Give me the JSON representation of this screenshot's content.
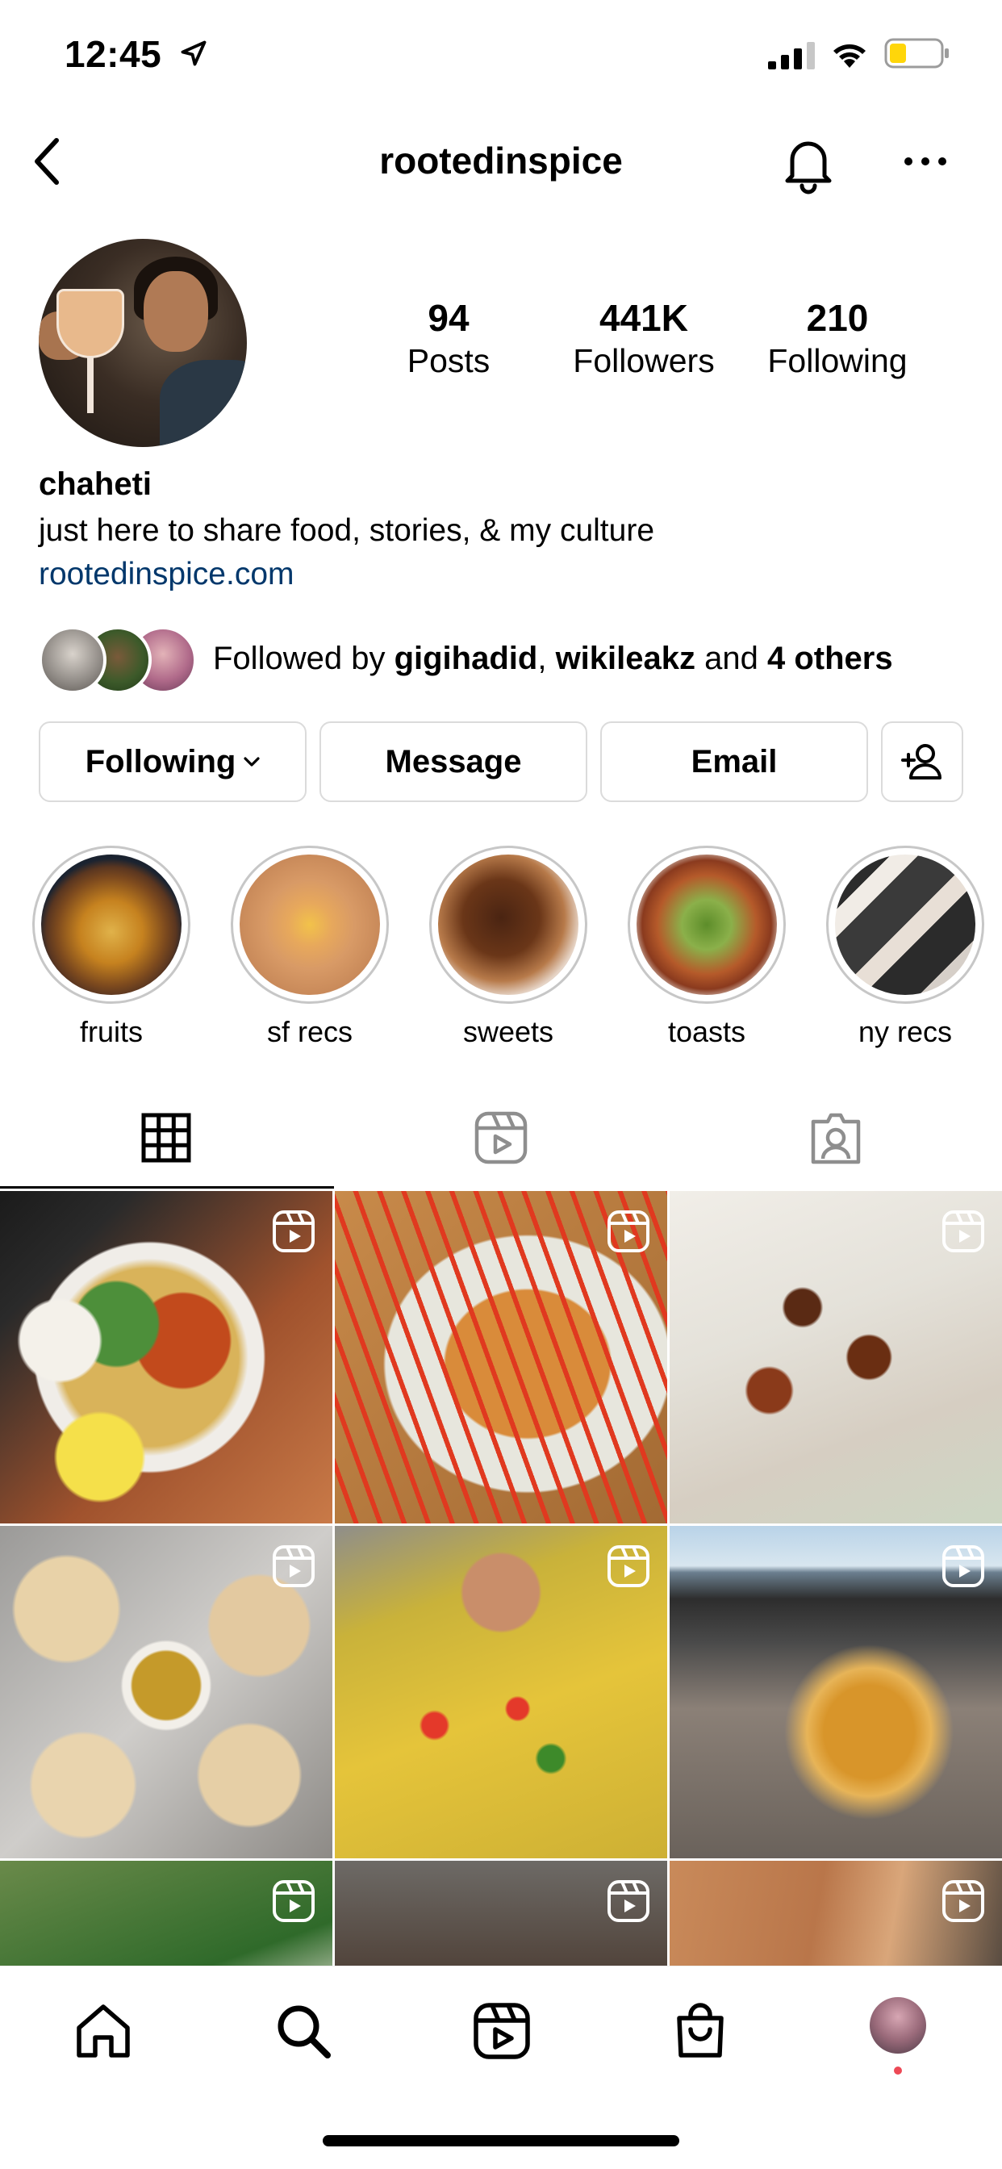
{
  "status_bar": {
    "time": "12:45"
  },
  "header": {
    "username": "rootedinspice"
  },
  "profile": {
    "stats": [
      {
        "value": "94",
        "label": "Posts"
      },
      {
        "value": "441K",
        "label": "Followers"
      },
      {
        "value": "210",
        "label": "Following"
      }
    ],
    "name": "chaheti",
    "bio": "just here to share food, stories, & my culture",
    "link": "rootedinspice.com",
    "followed_by": {
      "prefix": "Followed by ",
      "user1": "gigihadid",
      "sep": ", ",
      "user2": "wikileakz",
      "and": " and ",
      "others": "4 others"
    }
  },
  "actions": {
    "following": "Following",
    "message": "Message",
    "email": "Email"
  },
  "highlights": [
    {
      "label": "fruits"
    },
    {
      "label": "sf recs"
    },
    {
      "label": "sweets"
    },
    {
      "label": "toasts"
    },
    {
      "label": "ny recs"
    }
  ],
  "tabs": [
    "grid-icon",
    "reels-icon",
    "tagged-icon"
  ],
  "nav": [
    "home-icon",
    "search-icon",
    "reels-icon",
    "shop-icon",
    "profile-avatar"
  ],
  "colors": {
    "link": "#00376b",
    "border": "#dbdbdb",
    "notification_dot": "#ed4956"
  }
}
